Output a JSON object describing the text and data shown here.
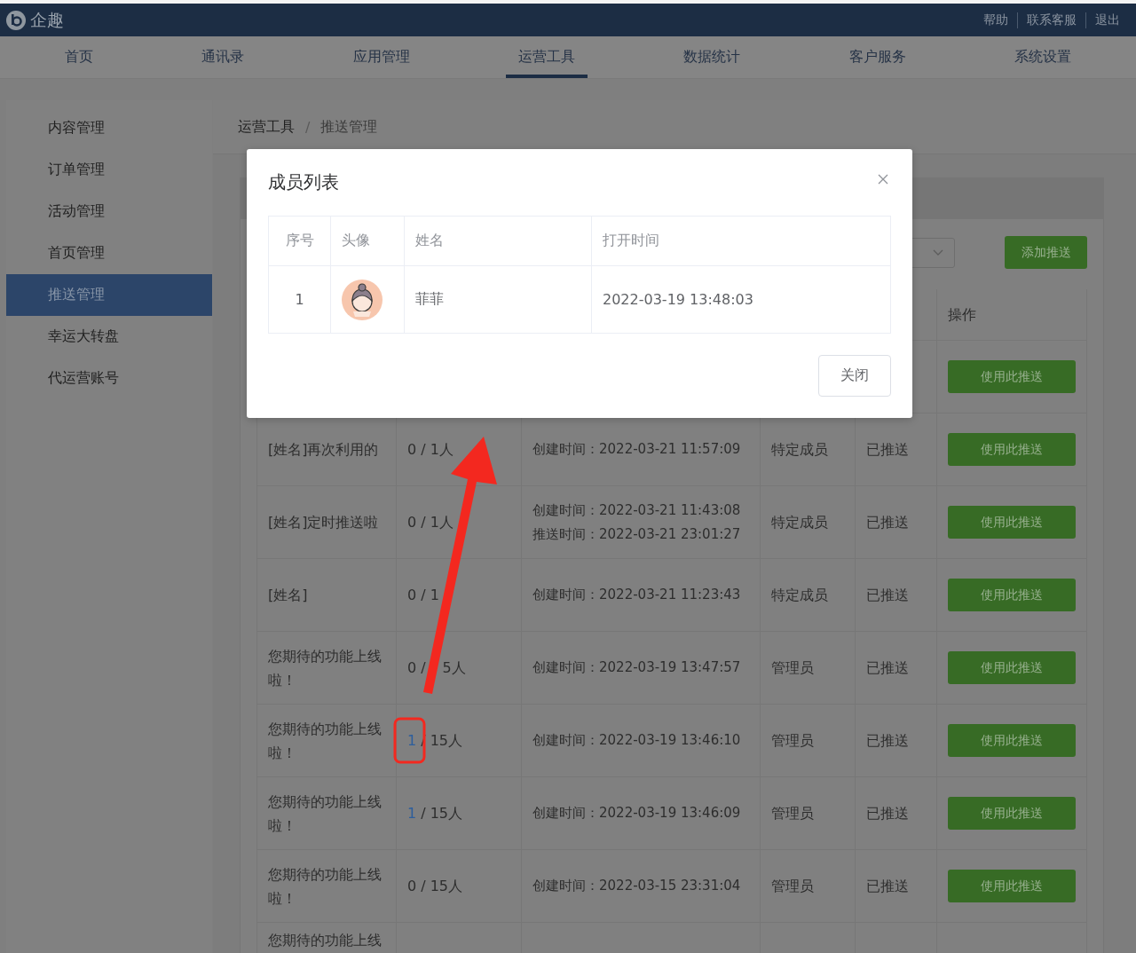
{
  "header": {
    "brand": "企趣",
    "links": [
      "帮助",
      "联系客服",
      "退出"
    ]
  },
  "nav": [
    {
      "label": "首页",
      "selected": false
    },
    {
      "label": "通讯录",
      "selected": false
    },
    {
      "label": "应用管理",
      "selected": false
    },
    {
      "label": "运营工具",
      "selected": true
    },
    {
      "label": "数据统计",
      "selected": false
    },
    {
      "label": "客户服务",
      "selected": false
    },
    {
      "label": "系统设置",
      "selected": false
    }
  ],
  "sidebar": [
    {
      "label": "内容管理",
      "selected": false
    },
    {
      "label": "订单管理",
      "selected": false
    },
    {
      "label": "活动管理",
      "selected": false
    },
    {
      "label": "首页管理",
      "selected": false
    },
    {
      "label": "推送管理",
      "selected": true
    },
    {
      "label": "幸运大转盘",
      "selected": false
    },
    {
      "label": "代运营账号",
      "selected": false
    }
  ],
  "breadcrumb": {
    "items": [
      "运营工具",
      "推送管理"
    ],
    "separator": "/"
  },
  "toolbar": {
    "add_button": "添加推送"
  },
  "table": {
    "action_header": "操作",
    "rows": [
      {
        "action": "使用此推送"
      },
      {
        "title": "[姓名]再次利用的",
        "count": {
          "opened": "0",
          "rest": "/ 1人",
          "link": false
        },
        "times": [
          "创建时间：2022-03-21 11:57:09"
        ],
        "target": "特定成员",
        "status": "已推送",
        "action": "使用此推送"
      },
      {
        "title": "[姓名]定时推送啦",
        "count": {
          "opened": "0",
          "rest": "/ 1人",
          "link": false
        },
        "times": [
          "创建时间：2022-03-21 11:43:08",
          "推送时间：2022-03-21 23:01:27"
        ],
        "target": "特定成员",
        "status": "已推送",
        "action": "使用此推送"
      },
      {
        "title": "[姓名]",
        "count": {
          "opened": "0",
          "rest": "/ 1",
          "link": false
        },
        "times": [
          "创建时间：2022-03-21 11:23:43"
        ],
        "target": "特定成员",
        "status": "已推送",
        "action": "使用此推送"
      },
      {
        "title": "您期待的功能上线啦！",
        "count": {
          "opened": "0",
          "rest": "/",
          "after_arrow": "5人",
          "link": false
        },
        "times": [
          "创建时间：2022-03-19 13:47:57"
        ],
        "target": "管理员",
        "status": "已推送",
        "action": "使用此推送"
      },
      {
        "title": "您期待的功能上线啦！",
        "count": {
          "opened": "1",
          "rest": "/ 15人",
          "link": true
        },
        "times": [
          "创建时间：2022-03-19 13:46:10"
        ],
        "target": "管理员",
        "status": "已推送",
        "action": "使用此推送"
      },
      {
        "title": "您期待的功能上线啦！",
        "count": {
          "opened": "1",
          "rest": "/ 15人",
          "link": true
        },
        "times": [
          "创建时间：2022-03-19 13:46:09"
        ],
        "target": "管理员",
        "status": "已推送",
        "action": "使用此推送"
      },
      {
        "title": "您期待的功能上线啦！",
        "count": {
          "opened": "0",
          "rest": "/ 15人",
          "link": false
        },
        "times": [
          "创建时间：2022-03-15 23:31:04"
        ],
        "target": "管理员",
        "status": "已推送",
        "action": "使用此推送"
      },
      {
        "title": "您期待的功能上线"
      }
    ]
  },
  "modal": {
    "title": "成员列表",
    "columns": [
      "序号",
      "头像",
      "姓名",
      "打开时间"
    ],
    "rows": [
      {
        "index": "1",
        "name": "菲菲",
        "time": "2022-03-19 13:48:03"
      }
    ],
    "close_button": "关闭"
  }
}
